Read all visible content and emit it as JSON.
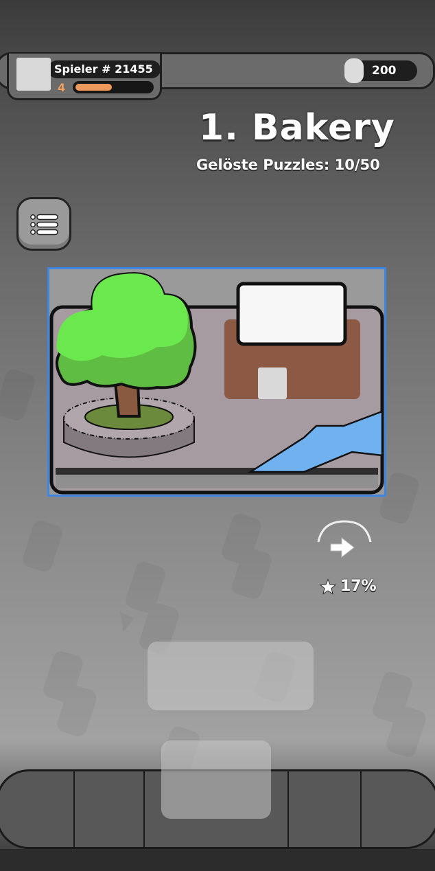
{
  "player": {
    "name": "Spieler # 21455",
    "level": "4",
    "xp_progress": 0.52
  },
  "currency": {
    "amount": "200"
  },
  "level": {
    "title": "1. Bakery",
    "progress_text": "Gelöste Puzzles: 10/50"
  },
  "puzzle": {
    "scene_name": "bakery-scene",
    "colors": {
      "frame_border": "#3f86e0",
      "ground": "#a69ba0",
      "tree_leaves": "#6ce84f",
      "tree_leaves_dark": "#5fbd43",
      "trunk": "#8a5a40",
      "building": "#8c5a44",
      "water": "#6fb2ef"
    }
  },
  "next": {
    "percent_label": "17%"
  },
  "icons": {
    "menu": "list-icon",
    "coin": "coin-icon",
    "next": "arrow-right-icon",
    "star": "star-icon"
  }
}
